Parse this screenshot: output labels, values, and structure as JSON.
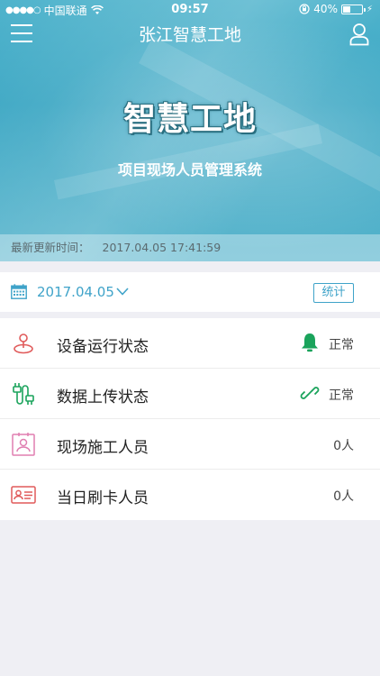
{
  "status_bar": {
    "carrier": "中国联通",
    "time": "09:57",
    "battery": "40%",
    "battery_level": 0.4
  },
  "nav": {
    "title": "张江智慧工地"
  },
  "hero": {
    "title": "智慧工地",
    "subtitle": "项目现场人员管理系统"
  },
  "update": {
    "label": "最新更新时间：",
    "value": "2017.04.05 17:41:59"
  },
  "date_bar": {
    "date": "2017.04.05",
    "stats_label": "统计"
  },
  "rows": [
    {
      "label": "设备运行状态",
      "value": "正常",
      "icon": "location-pin-icon",
      "status_icon": "bell-icon"
    },
    {
      "label": "数据上传状态",
      "value": "正常",
      "icon": "plug-icon",
      "status_icon": "link-icon"
    },
    {
      "label": "现场施工人员",
      "value": "0人",
      "icon": "badge-icon"
    },
    {
      "label": "当日刷卡人员",
      "value": "0人",
      "icon": "id-card-icon"
    }
  ],
  "colors": {
    "accent": "#3fa3c9",
    "ok_green": "#1aa35b",
    "icon_red": "#e05a5a",
    "icon_pink": "#e07fb1"
  }
}
